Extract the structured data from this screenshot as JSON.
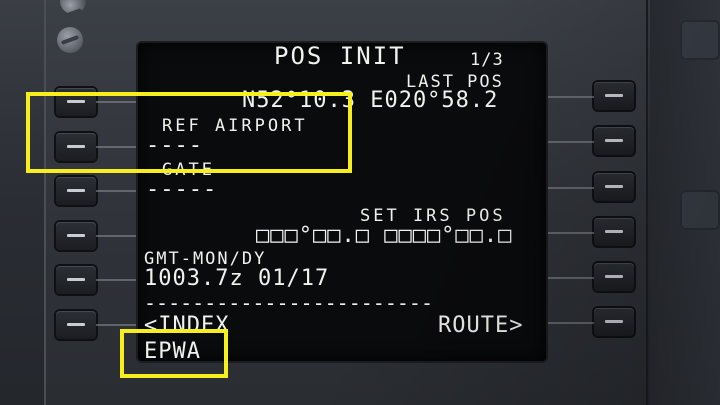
{
  "page": {
    "title": "POS INIT",
    "page_indicator": "1/3"
  },
  "rows": {
    "last_pos_label": "LAST POS",
    "last_pos_value": "N52°10.3 E020°58.2",
    "ref_airport_label": "REF AIRPORT",
    "ref_airport_value": "----",
    "gate_label": "GATE",
    "gate_value": "-----",
    "set_irs_pos_label": "SET IRS POS",
    "set_irs_pos_value": "□□□°□□.□ □□□□°□□.□",
    "gmt_label": "GMT-MON/DY",
    "gmt_value": "1003.7z 01/17",
    "separator": "------------------------",
    "index_link": "<INDEX",
    "route_link": "ROUTE>"
  },
  "scratchpad": "EPWA",
  "colors": {
    "screen_text": "#f1f1ee",
    "screen_bg": "#0a0b0d",
    "highlight": "#f6ee1f"
  }
}
